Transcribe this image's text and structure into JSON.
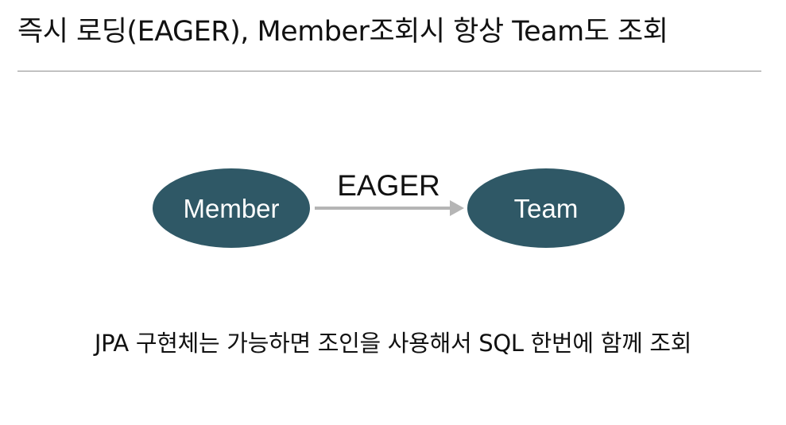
{
  "slide": {
    "title": "즉시 로딩(EAGER), Member조회시 항상 Team도 조회",
    "caption": "JPA 구현체는 가능하면 조인을 사용해서 SQL 한번에 함께 조회"
  },
  "diagram": {
    "nodes": [
      {
        "id": "member",
        "label": "Member"
      },
      {
        "id": "team",
        "label": "Team"
      }
    ],
    "edges": [
      {
        "from": "member",
        "to": "team",
        "label": "EAGER"
      }
    ],
    "colors": {
      "node_fill": "#2f5866",
      "node_text": "#ffffff",
      "arrow": "#b5b5b5",
      "divider": "#8e8e8e",
      "text": "#111111"
    }
  }
}
